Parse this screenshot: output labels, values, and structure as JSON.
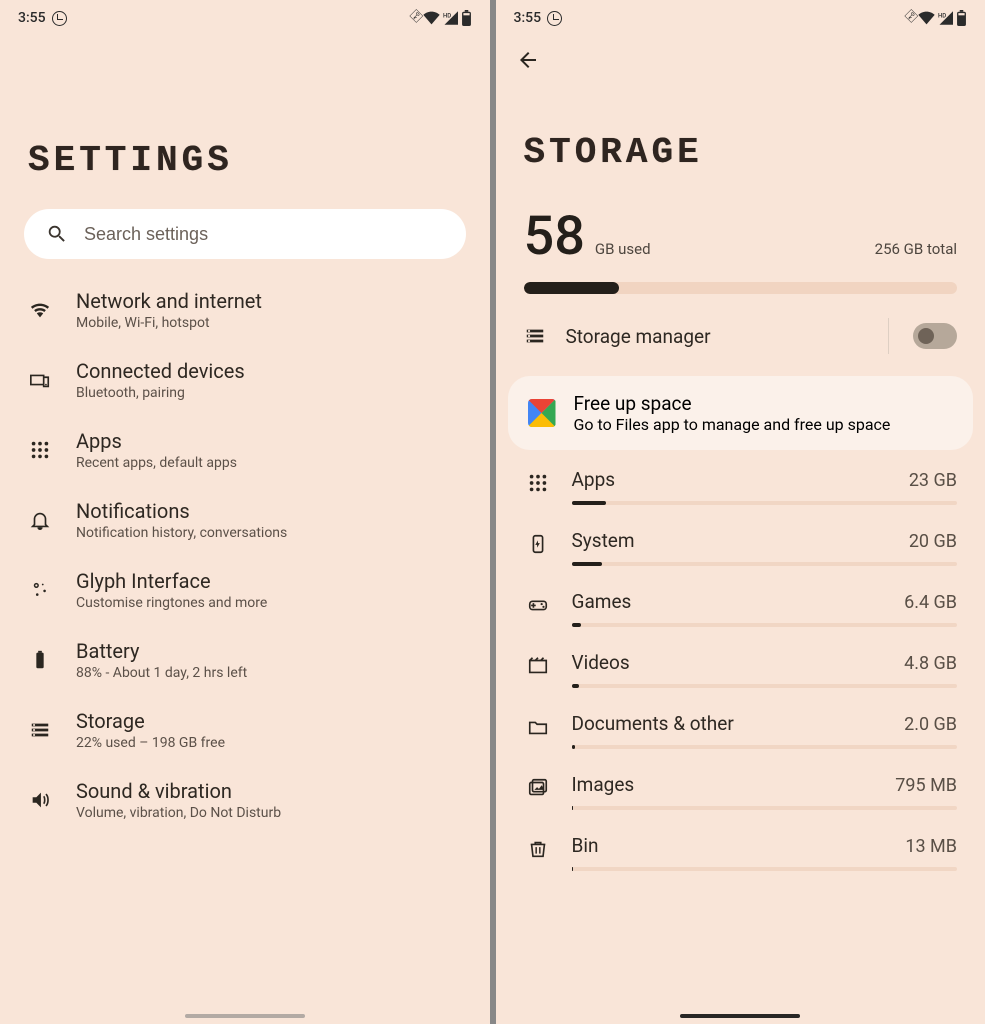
{
  "status": {
    "time": "3:55"
  },
  "settings": {
    "title": "SETTINGS",
    "search_placeholder": "Search settings",
    "items": [
      {
        "icon": "wifi",
        "title": "Network and internet",
        "sub": "Mobile, Wi-Fi, hotspot"
      },
      {
        "icon": "devices",
        "title": "Connected devices",
        "sub": "Bluetooth, pairing"
      },
      {
        "icon": "apps",
        "title": "Apps",
        "sub": "Recent apps, default apps"
      },
      {
        "icon": "bell",
        "title": "Notifications",
        "sub": "Notification history, conversations"
      },
      {
        "icon": "glyph",
        "title": "Glyph Interface",
        "sub": "Customise ringtones and more"
      },
      {
        "icon": "battery",
        "title": "Battery",
        "sub": "88% - About 1 day, 2 hrs left"
      },
      {
        "icon": "storage",
        "title": "Storage",
        "sub": "22% used – 198 GB free"
      },
      {
        "icon": "sound",
        "title": "Sound & vibration",
        "sub": "Volume, vibration, Do Not Disturb"
      }
    ]
  },
  "storage": {
    "title": "STORAGE",
    "used_number": "58",
    "used_label": "GB used",
    "total_label": "256 GB total",
    "used_percent": 22,
    "manager_label": "Storage manager",
    "manager_on": false,
    "free_up_title": "Free up space",
    "free_up_sub": "Go to Files app to manage and free up space",
    "categories": [
      {
        "icon": "apps",
        "name": "Apps",
        "amount": "23 GB",
        "pct": 9.0
      },
      {
        "icon": "system",
        "name": "System",
        "amount": "20 GB",
        "pct": 7.8
      },
      {
        "icon": "games",
        "name": "Games",
        "amount": "6.4 GB",
        "pct": 2.5
      },
      {
        "icon": "videos",
        "name": "Videos",
        "amount": "4.8 GB",
        "pct": 1.9
      },
      {
        "icon": "folder",
        "name": "Documents & other",
        "amount": "2.0 GB",
        "pct": 0.8
      },
      {
        "icon": "images",
        "name": "Images",
        "amount": "795 MB",
        "pct": 0.3
      },
      {
        "icon": "trash",
        "name": "Bin",
        "amount": "13 MB",
        "pct": 0.0
      }
    ]
  }
}
